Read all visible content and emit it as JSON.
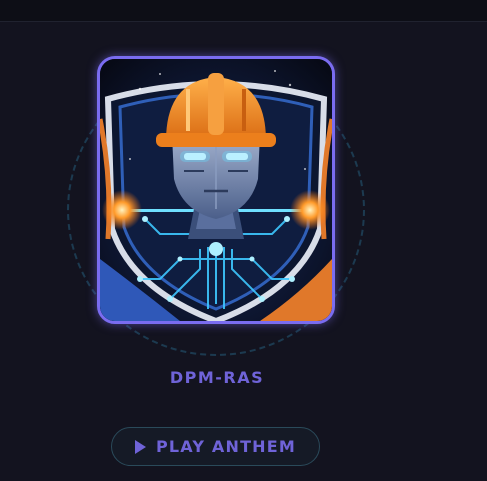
{
  "profile": {
    "name": "DPM-RAS"
  },
  "actions": {
    "play_label": "PLAY ANTHEM"
  },
  "colors": {
    "accent": "#6f63d8",
    "frame_border": "#7a6cf0",
    "helmet": "#f08a24",
    "circuit_glow": "#3ec8ff",
    "background": "#13131f"
  },
  "icons": {
    "play": "play-icon",
    "emblem": "robot-engineer-emblem"
  }
}
